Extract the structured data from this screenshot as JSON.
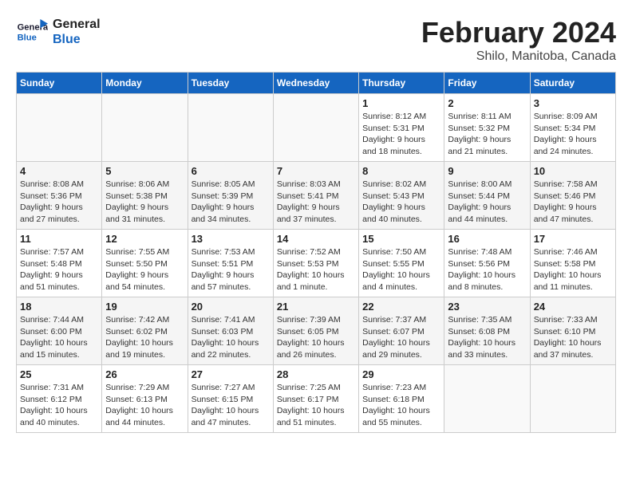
{
  "header": {
    "logo_line1": "General",
    "logo_line2": "Blue",
    "month": "February 2024",
    "location": "Shilo, Manitoba, Canada"
  },
  "weekdays": [
    "Sunday",
    "Monday",
    "Tuesday",
    "Wednesday",
    "Thursday",
    "Friday",
    "Saturday"
  ],
  "weeks": [
    [
      {
        "day": "",
        "info": ""
      },
      {
        "day": "",
        "info": ""
      },
      {
        "day": "",
        "info": ""
      },
      {
        "day": "",
        "info": ""
      },
      {
        "day": "1",
        "info": "Sunrise: 8:12 AM\nSunset: 5:31 PM\nDaylight: 9 hours\nand 18 minutes."
      },
      {
        "day": "2",
        "info": "Sunrise: 8:11 AM\nSunset: 5:32 PM\nDaylight: 9 hours\nand 21 minutes."
      },
      {
        "day": "3",
        "info": "Sunrise: 8:09 AM\nSunset: 5:34 PM\nDaylight: 9 hours\nand 24 minutes."
      }
    ],
    [
      {
        "day": "4",
        "info": "Sunrise: 8:08 AM\nSunset: 5:36 PM\nDaylight: 9 hours\nand 27 minutes."
      },
      {
        "day": "5",
        "info": "Sunrise: 8:06 AM\nSunset: 5:38 PM\nDaylight: 9 hours\nand 31 minutes."
      },
      {
        "day": "6",
        "info": "Sunrise: 8:05 AM\nSunset: 5:39 PM\nDaylight: 9 hours\nand 34 minutes."
      },
      {
        "day": "7",
        "info": "Sunrise: 8:03 AM\nSunset: 5:41 PM\nDaylight: 9 hours\nand 37 minutes."
      },
      {
        "day": "8",
        "info": "Sunrise: 8:02 AM\nSunset: 5:43 PM\nDaylight: 9 hours\nand 40 minutes."
      },
      {
        "day": "9",
        "info": "Sunrise: 8:00 AM\nSunset: 5:44 PM\nDaylight: 9 hours\nand 44 minutes."
      },
      {
        "day": "10",
        "info": "Sunrise: 7:58 AM\nSunset: 5:46 PM\nDaylight: 9 hours\nand 47 minutes."
      }
    ],
    [
      {
        "day": "11",
        "info": "Sunrise: 7:57 AM\nSunset: 5:48 PM\nDaylight: 9 hours\nand 51 minutes."
      },
      {
        "day": "12",
        "info": "Sunrise: 7:55 AM\nSunset: 5:50 PM\nDaylight: 9 hours\nand 54 minutes."
      },
      {
        "day": "13",
        "info": "Sunrise: 7:53 AM\nSunset: 5:51 PM\nDaylight: 9 hours\nand 57 minutes."
      },
      {
        "day": "14",
        "info": "Sunrise: 7:52 AM\nSunset: 5:53 PM\nDaylight: 10 hours\nand 1 minute."
      },
      {
        "day": "15",
        "info": "Sunrise: 7:50 AM\nSunset: 5:55 PM\nDaylight: 10 hours\nand 4 minutes."
      },
      {
        "day": "16",
        "info": "Sunrise: 7:48 AM\nSunset: 5:56 PM\nDaylight: 10 hours\nand 8 minutes."
      },
      {
        "day": "17",
        "info": "Sunrise: 7:46 AM\nSunset: 5:58 PM\nDaylight: 10 hours\nand 11 minutes."
      }
    ],
    [
      {
        "day": "18",
        "info": "Sunrise: 7:44 AM\nSunset: 6:00 PM\nDaylight: 10 hours\nand 15 minutes."
      },
      {
        "day": "19",
        "info": "Sunrise: 7:42 AM\nSunset: 6:02 PM\nDaylight: 10 hours\nand 19 minutes."
      },
      {
        "day": "20",
        "info": "Sunrise: 7:41 AM\nSunset: 6:03 PM\nDaylight: 10 hours\nand 22 minutes."
      },
      {
        "day": "21",
        "info": "Sunrise: 7:39 AM\nSunset: 6:05 PM\nDaylight: 10 hours\nand 26 minutes."
      },
      {
        "day": "22",
        "info": "Sunrise: 7:37 AM\nSunset: 6:07 PM\nDaylight: 10 hours\nand 29 minutes."
      },
      {
        "day": "23",
        "info": "Sunrise: 7:35 AM\nSunset: 6:08 PM\nDaylight: 10 hours\nand 33 minutes."
      },
      {
        "day": "24",
        "info": "Sunrise: 7:33 AM\nSunset: 6:10 PM\nDaylight: 10 hours\nand 37 minutes."
      }
    ],
    [
      {
        "day": "25",
        "info": "Sunrise: 7:31 AM\nSunset: 6:12 PM\nDaylight: 10 hours\nand 40 minutes."
      },
      {
        "day": "26",
        "info": "Sunrise: 7:29 AM\nSunset: 6:13 PM\nDaylight: 10 hours\nand 44 minutes."
      },
      {
        "day": "27",
        "info": "Sunrise: 7:27 AM\nSunset: 6:15 PM\nDaylight: 10 hours\nand 47 minutes."
      },
      {
        "day": "28",
        "info": "Sunrise: 7:25 AM\nSunset: 6:17 PM\nDaylight: 10 hours\nand 51 minutes."
      },
      {
        "day": "29",
        "info": "Sunrise: 7:23 AM\nSunset: 6:18 PM\nDaylight: 10 hours\nand 55 minutes."
      },
      {
        "day": "",
        "info": ""
      },
      {
        "day": "",
        "info": ""
      }
    ]
  ]
}
